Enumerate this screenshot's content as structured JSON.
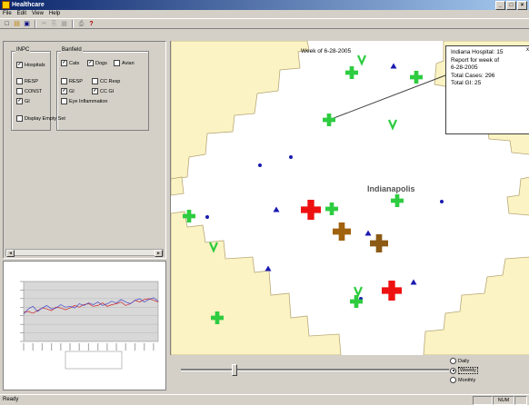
{
  "window": {
    "title": "Healthcare",
    "buttons": [
      "_",
      "□",
      "×"
    ]
  },
  "menu": [
    "File",
    "Edit",
    "View",
    "Help"
  ],
  "toolbar": {
    "icons": [
      "new-icon",
      "open-icon",
      "save-icon",
      "cut-icon",
      "copy-icon",
      "paste-icon",
      "print-icon",
      "help-icon"
    ],
    "glyphs": [
      "□",
      "▤",
      "▣",
      "✂",
      "⎘",
      "▦",
      "⎙",
      "?"
    ]
  },
  "inpc": {
    "title": "INPC",
    "items": [
      {
        "label": "Hospitals",
        "checked": true
      },
      {
        "label": "RESP",
        "checked": false
      },
      {
        "label": "CONST",
        "checked": false
      },
      {
        "label": "GI",
        "checked": true
      }
    ]
  },
  "banfield": {
    "title": "Banfield",
    "species": [
      {
        "label": "Cats",
        "checked": true
      },
      {
        "label": "Dogs",
        "checked": true
      },
      {
        "label": "Avian",
        "checked": false
      }
    ],
    "items": [
      {
        "label": "RESP",
        "checked": false
      },
      {
        "label": "CC Resp",
        "checked": false
      },
      {
        "label": "GI",
        "checked": true
      },
      {
        "label": "CC GI",
        "checked": true
      },
      {
        "label": "Eye Inflammation",
        "checked": false
      }
    ]
  },
  "display_empty_set": {
    "label": "Display Empty Set",
    "checked": false
  },
  "map": {
    "week_label": "Week of 6-28-2005",
    "city": "Indianapolis",
    "callout": {
      "lines": [
        "Indiana Hospital: 15",
        "Report for week of",
        "6-28-2005",
        "Total Cases: 296",
        "Total GI: 25"
      ],
      "close": "x"
    },
    "colors": {
      "county": "#fbf3c3",
      "green": "#2ecc40",
      "red": "#ee1111",
      "brown": "#a0620c",
      "dark_brown": "#8b5a14",
      "blue": "#1a1ab0"
    }
  },
  "range": {
    "options": [
      {
        "label": "Daily",
        "selected": false
      },
      {
        "label": "Weekly",
        "selected": true
      },
      {
        "label": "Monthly",
        "selected": false
      }
    ]
  },
  "status": {
    "text": "Ready",
    "num": "NUM"
  },
  "chart_data": {
    "type": "line",
    "ylim": [
      0,
      7
    ],
    "x": [
      0,
      1,
      2,
      3,
      4,
      5,
      6,
      7,
      8,
      9,
      10,
      11,
      12,
      13,
      14,
      15,
      16,
      17,
      18,
      19,
      20,
      21,
      22,
      23,
      24,
      25,
      26,
      27,
      28,
      29
    ],
    "series": [
      {
        "values": [
          3.4,
          3.5,
          3.3,
          3.6,
          3.9,
          3.8,
          3.6,
          4.0,
          3.9,
          3.7,
          3.9,
          4.2,
          4.0,
          4.3,
          4.4,
          4.1,
          4.2,
          4.5,
          4.1,
          4.3,
          4.4,
          4.6,
          4.2,
          4.4,
          4.8,
          4.6,
          4.9,
          5.0,
          4.8,
          4.6
        ]
      },
      {
        "values": [
          3.2,
          3.8,
          4.1,
          3.5,
          3.9,
          4.2,
          3.8,
          3.9,
          4.3,
          4.0,
          4.1,
          3.9,
          4.4,
          4.2,
          4.5,
          4.3,
          4.6,
          4.2,
          4.4,
          4.7,
          4.5,
          4.9,
          4.6,
          4.4,
          4.8,
          5.0,
          4.6,
          4.9,
          5.1,
          4.7
        ]
      }
    ],
    "colors": [
      "#cc2222",
      "#4444cc"
    ]
  }
}
